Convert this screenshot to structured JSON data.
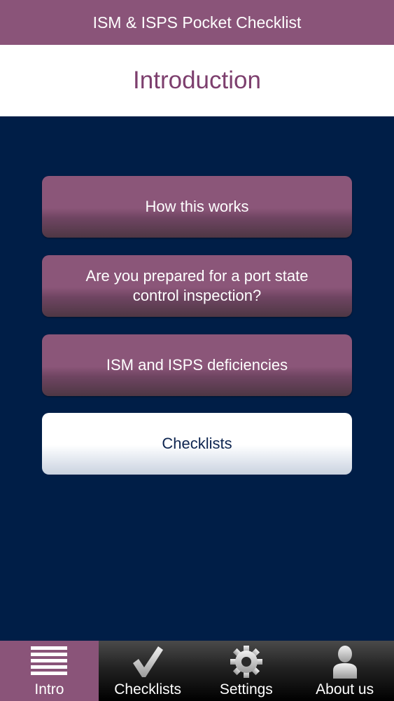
{
  "app": {
    "title": "ISM & ISPS Pocket Checklist"
  },
  "page": {
    "title": "Introduction"
  },
  "menu": [
    {
      "label": "How this works"
    },
    {
      "label": "Are you prepared for a port state control inspection?"
    },
    {
      "label": "ISM and ISPS deficiencies"
    },
    {
      "label": "Checklists"
    }
  ],
  "tabs": [
    {
      "label": "Intro",
      "icon": "list-icon",
      "active": true
    },
    {
      "label": "Checklists",
      "icon": "checkmark-icon",
      "active": false
    },
    {
      "label": "Settings",
      "icon": "gear-icon",
      "active": false
    },
    {
      "label": "About us",
      "icon": "person-icon",
      "active": false
    }
  ],
  "colors": {
    "header": "#8a5479",
    "title_text": "#7d3f6e",
    "background": "#001e47",
    "button_purple": "#8b5679",
    "button_white_text": "#0e2550"
  }
}
